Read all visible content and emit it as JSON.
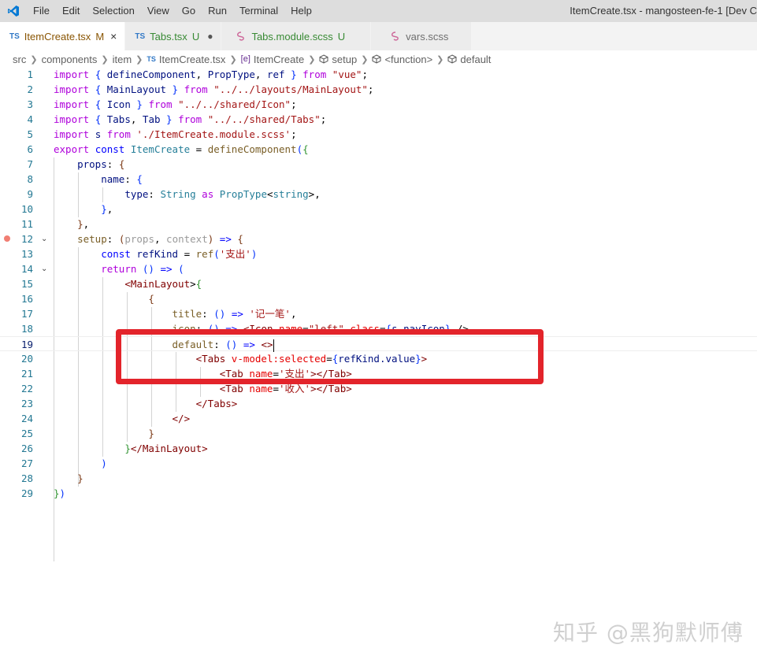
{
  "titlebar": {
    "menu": [
      "File",
      "Edit",
      "Selection",
      "View",
      "Go",
      "Run",
      "Terminal",
      "Help"
    ],
    "window_title": "ItemCreate.tsx - mangosteen-fe-1 [Dev C"
  },
  "tabs": [
    {
      "icon": "TS",
      "label": "ItemCreate.tsx",
      "status": "M",
      "close": "×"
    },
    {
      "icon": "TS",
      "label": "Tabs.tsx",
      "status": "U",
      "dot": "●"
    },
    {
      "icon": "scss-icon",
      "label": "Tabs.module.scss",
      "status": "U"
    },
    {
      "icon": "scss-icon",
      "label": "vars.scss"
    }
  ],
  "breadcrumb": {
    "items": [
      "src",
      "components",
      "item",
      "ItemCreate.tsx",
      "ItemCreate",
      "setup",
      "<function>",
      "default"
    ],
    "ts_badge": "TS",
    "sym_badge": "[e]"
  },
  "editor": {
    "line_numbers": [
      "1",
      "2",
      "3",
      "4",
      "5",
      "6",
      "7",
      "8",
      "9",
      "10",
      "11",
      "12",
      "13",
      "14",
      "15",
      "16",
      "17",
      "18",
      "19",
      "20",
      "21",
      "22",
      "23",
      "24",
      "25",
      "26",
      "27",
      "28",
      "29"
    ],
    "lines": [
      [
        [
          "kw",
          "import"
        ],
        [
          "p",
          " "
        ],
        [
          "b1",
          "{"
        ],
        [
          "p",
          " "
        ],
        [
          "var",
          "defineComponent"
        ],
        [
          "p",
          ", "
        ],
        [
          "var",
          "PropType"
        ],
        [
          "p",
          ", "
        ],
        [
          "var",
          "ref"
        ],
        [
          "p",
          " "
        ],
        [
          "b1",
          "}"
        ],
        [
          "p",
          " "
        ],
        [
          "kw",
          "from"
        ],
        [
          "p",
          " "
        ],
        [
          "str",
          "\"vue\""
        ],
        [
          "p",
          ";"
        ]
      ],
      [
        [
          "kw",
          "import"
        ],
        [
          "p",
          " "
        ],
        [
          "b1",
          "{"
        ],
        [
          "p",
          " "
        ],
        [
          "var",
          "MainLayout"
        ],
        [
          "p",
          " "
        ],
        [
          "b1",
          "}"
        ],
        [
          "p",
          " "
        ],
        [
          "kw",
          "from"
        ],
        [
          "p",
          " "
        ],
        [
          "str",
          "\"../../layouts/MainLayout\""
        ],
        [
          "p",
          ";"
        ]
      ],
      [
        [
          "kw",
          "import"
        ],
        [
          "p",
          " "
        ],
        [
          "b1",
          "{"
        ],
        [
          "p",
          " "
        ],
        [
          "var",
          "Icon"
        ],
        [
          "p",
          " "
        ],
        [
          "b1",
          "}"
        ],
        [
          "p",
          " "
        ],
        [
          "kw",
          "from"
        ],
        [
          "p",
          " "
        ],
        [
          "str",
          "\"../../shared/Icon\""
        ],
        [
          "p",
          ";"
        ]
      ],
      [
        [
          "kw",
          "import"
        ],
        [
          "p",
          " "
        ],
        [
          "b1",
          "{"
        ],
        [
          "p",
          " "
        ],
        [
          "var",
          "Tabs"
        ],
        [
          "p",
          ", "
        ],
        [
          "var",
          "Tab"
        ],
        [
          "p",
          " "
        ],
        [
          "b1",
          "}"
        ],
        [
          "p",
          " "
        ],
        [
          "kw",
          "from"
        ],
        [
          "p",
          " "
        ],
        [
          "str",
          "\"../../shared/Tabs\""
        ],
        [
          "p",
          ";"
        ]
      ],
      [
        [
          "kw",
          "import"
        ],
        [
          "p",
          " "
        ],
        [
          "var",
          "s"
        ],
        [
          "p",
          " "
        ],
        [
          "kw",
          "from"
        ],
        [
          "p",
          " "
        ],
        [
          "str",
          "'./ItemCreate.module.scss'"
        ],
        [
          "p",
          ";"
        ]
      ],
      [
        [
          "kw",
          "export"
        ],
        [
          "p",
          " "
        ],
        [
          "kw2",
          "const"
        ],
        [
          "p",
          " "
        ],
        [
          "type",
          "ItemCreate"
        ],
        [
          "p",
          " = "
        ],
        [
          "fn",
          "defineComponent"
        ],
        [
          "b1",
          "("
        ],
        [
          "b2",
          "{"
        ]
      ],
      [
        [
          "p",
          "    "
        ],
        [
          "var",
          "props"
        ],
        [
          "p",
          ": "
        ],
        [
          "b3",
          "{"
        ]
      ],
      [
        [
          "p",
          "        "
        ],
        [
          "var",
          "name"
        ],
        [
          "p",
          ": "
        ],
        [
          "b1",
          "{"
        ]
      ],
      [
        [
          "p",
          "            "
        ],
        [
          "var",
          "type"
        ],
        [
          "p",
          ": "
        ],
        [
          "type",
          "String"
        ],
        [
          "p",
          " "
        ],
        [
          "kw",
          "as"
        ],
        [
          "p",
          " "
        ],
        [
          "type",
          "PropType"
        ],
        [
          "p",
          "<"
        ],
        [
          "type",
          "string"
        ],
        [
          "p",
          ">,"
        ]
      ],
      [
        [
          "p",
          "        "
        ],
        [
          "b1",
          "}"
        ],
        [
          "p",
          ","
        ]
      ],
      [
        [
          "p",
          "    "
        ],
        [
          "b3",
          "}"
        ],
        [
          "p",
          ","
        ]
      ],
      [
        [
          "p",
          "    "
        ],
        [
          "fn",
          "setup"
        ],
        [
          "p",
          ": "
        ],
        [
          "b3",
          "("
        ],
        [
          "param",
          "props"
        ],
        [
          "p",
          ", "
        ],
        [
          "param",
          "context"
        ],
        [
          "b3",
          ")"
        ],
        [
          "p",
          " "
        ],
        [
          "kw2",
          "=>"
        ],
        [
          "p",
          " "
        ],
        [
          "b3",
          "{"
        ]
      ],
      [
        [
          "p",
          "        "
        ],
        [
          "kw2",
          "const"
        ],
        [
          "p",
          " "
        ],
        [
          "var",
          "refKind"
        ],
        [
          "p",
          " = "
        ],
        [
          "fn",
          "ref"
        ],
        [
          "b1",
          "("
        ],
        [
          "str",
          "'支出'"
        ],
        [
          "b1",
          ")"
        ]
      ],
      [
        [
          "p",
          "        "
        ],
        [
          "kw",
          "return"
        ],
        [
          "p",
          " "
        ],
        [
          "b1",
          "()"
        ],
        [
          "p",
          " "
        ],
        [
          "kw2",
          "=>"
        ],
        [
          "p",
          " "
        ],
        [
          "b1",
          "("
        ]
      ],
      [
        [
          "p",
          "            "
        ],
        [
          "tag",
          "<MainLayout"
        ],
        [
          "p",
          ">"
        ],
        [
          "b2",
          "{"
        ]
      ],
      [
        [
          "p",
          "                "
        ],
        [
          "b3",
          "{"
        ]
      ],
      [
        [
          "p",
          "                    "
        ],
        [
          "fn",
          "title"
        ],
        [
          "p",
          ": "
        ],
        [
          "b1",
          "()"
        ],
        [
          "p",
          " "
        ],
        [
          "kw2",
          "=>"
        ],
        [
          "p",
          " "
        ],
        [
          "str",
          "'记一笔'"
        ],
        [
          "p",
          ","
        ]
      ],
      [
        [
          "p",
          "                    "
        ],
        [
          "fn",
          "icon"
        ],
        [
          "p",
          ": "
        ],
        [
          "b1",
          "()"
        ],
        [
          "p",
          " "
        ],
        [
          "kw2",
          "=>"
        ],
        [
          "p",
          " "
        ],
        [
          "tag",
          "<Icon"
        ],
        [
          "p",
          " "
        ],
        [
          "attr",
          "name"
        ],
        [
          "p",
          "="
        ],
        [
          "str",
          "\"left\""
        ],
        [
          "p",
          " "
        ],
        [
          "attr",
          "class"
        ],
        [
          "p",
          "="
        ],
        [
          "b1",
          "{"
        ],
        [
          "var",
          "s.navIcon"
        ],
        [
          "b1",
          "}"
        ],
        [
          "p",
          " />"
        ]
      ],
      [
        [
          "p",
          "                    "
        ],
        [
          "fn",
          "default"
        ],
        [
          "p",
          ": "
        ],
        [
          "b1",
          "()"
        ],
        [
          "p",
          " "
        ],
        [
          "kw2",
          "=>"
        ],
        [
          "p",
          " "
        ],
        [
          "tag",
          "<>"
        ]
      ],
      [
        [
          "p",
          "                        "
        ],
        [
          "tag",
          "<Tabs"
        ],
        [
          "p",
          " "
        ],
        [
          "attr",
          "v-model:selected"
        ],
        [
          "p",
          "="
        ],
        [
          "b1",
          "{"
        ],
        [
          "var",
          "refKind.value"
        ],
        [
          "b1",
          "}"
        ],
        [
          "tag",
          ">"
        ]
      ],
      [
        [
          "p",
          "                            "
        ],
        [
          "tag",
          "<Tab"
        ],
        [
          "p",
          " "
        ],
        [
          "attr",
          "name"
        ],
        [
          "p",
          "="
        ],
        [
          "str",
          "'支出'"
        ],
        [
          "tag",
          "></Tab>"
        ]
      ],
      [
        [
          "p",
          "                            "
        ],
        [
          "tag",
          "<Tab"
        ],
        [
          "p",
          " "
        ],
        [
          "attr",
          "name"
        ],
        [
          "p",
          "="
        ],
        [
          "str",
          "'收入'"
        ],
        [
          "tag",
          "></Tab>"
        ]
      ],
      [
        [
          "p",
          "                        "
        ],
        [
          "tag",
          "</Tabs>"
        ]
      ],
      [
        [
          "p",
          "                    "
        ],
        [
          "tag",
          "</>"
        ]
      ],
      [
        [
          "p",
          "                "
        ],
        [
          "b3",
          "}"
        ]
      ],
      [
        [
          "p",
          "            "
        ],
        [
          "b2",
          "}"
        ],
        [
          "tag",
          "</MainLayout>"
        ]
      ],
      [
        [
          "p",
          "        "
        ],
        [
          "b1",
          ")"
        ]
      ],
      [
        [
          "p",
          "    "
        ],
        [
          "b3",
          "}"
        ]
      ],
      [
        [
          "b2",
          "}"
        ],
        [
          "b1",
          ")"
        ]
      ]
    ]
  },
  "watermark": "知乎 @黑狗默师傅"
}
